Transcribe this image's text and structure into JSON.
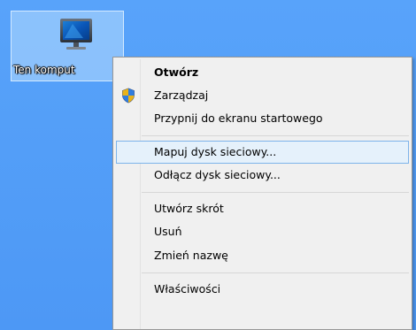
{
  "desktop": {
    "icon_label": "Ten komput"
  },
  "context_menu": {
    "items": [
      {
        "label": "Otwórz",
        "bold": true
      },
      {
        "label": "Zarządzaj",
        "icon": "uac-shield-icon"
      },
      {
        "label": "Przypnij do ekranu startowego"
      },
      {
        "label": "Mapuj dysk sieciowy...",
        "highlighted": true
      },
      {
        "label": "Odłącz dysk sieciowy..."
      },
      {
        "label": "Utwórz skrót"
      },
      {
        "label": "Usuń"
      },
      {
        "label": "Zmień nazwę"
      },
      {
        "label": "Właściwości"
      }
    ]
  },
  "colors": {
    "desktop_background": "#4f9bf6",
    "menu_background": "#f0f0f0",
    "highlight_background": "#e5f1fb",
    "highlight_border": "#7eb4ea"
  }
}
